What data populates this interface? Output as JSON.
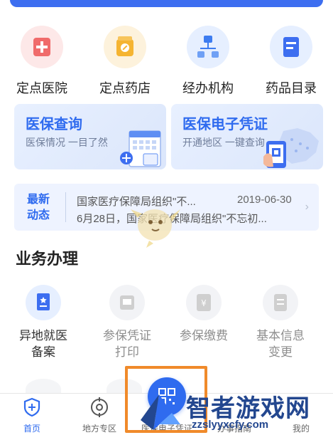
{
  "quick_entries": [
    {
      "label": "定点医院",
      "icon": "hospital-icon",
      "color": "#f06b6b",
      "bg": "#fde8e8"
    },
    {
      "label": "定点药店",
      "icon": "pharmacy-icon",
      "color": "#f5b431",
      "bg": "#fdf2dc"
    },
    {
      "label": "经办机构",
      "icon": "org-chart-icon",
      "color": "#3d7cf0",
      "bg": "#e6efff"
    },
    {
      "label": "药品目录",
      "icon": "catalog-icon",
      "color": "#3d6ef0",
      "bg": "#e6efff"
    }
  ],
  "cards": {
    "query": {
      "title": "医保查询",
      "subtitle": "医保情况 一目了然"
    },
    "voucher": {
      "title": "医保电子凭证",
      "subtitle": "开通地区 一键查询"
    }
  },
  "news": {
    "tag_line1": "最新",
    "tag_line2": "动态",
    "line1": "国家医疗保障局组织\"不...",
    "date": "2019-06-30",
    "line2": "6月28日，国家医疗保障局组织\"不忘初..."
  },
  "section_title": "业务办理",
  "business_items": [
    {
      "label_line1": "异地就医",
      "label_line2": "备案",
      "icon": "remote-medical-icon",
      "active": true
    },
    {
      "label_line1": "参保凭证",
      "label_line2": "打印",
      "icon": "print-icon",
      "active": false
    },
    {
      "label_line1": "参保缴费",
      "label_line2": "",
      "icon": "yen-payment-icon",
      "active": false
    },
    {
      "label_line1": "基本信息",
      "label_line2": "变更",
      "icon": "info-change-icon",
      "active": false
    }
  ],
  "bottom_nav": [
    {
      "label": "首页",
      "icon": "home-shield-icon",
      "active": true
    },
    {
      "label": "地方专区",
      "icon": "location-target-icon",
      "active": false
    },
    {
      "label": "医保电子凭证",
      "icon": "qr-voucher-icon",
      "active": false
    },
    {
      "label": "办事指南",
      "icon": "guide-icon",
      "active": false
    },
    {
      "label": "我的",
      "icon": "profile-icon",
      "active": false
    }
  ],
  "watermark": {
    "main": "智者游戏网",
    "sub": "zzslyyxcfy.com"
  },
  "colors": {
    "accent": "#2f6bef",
    "highlight": "#f08a2a"
  }
}
